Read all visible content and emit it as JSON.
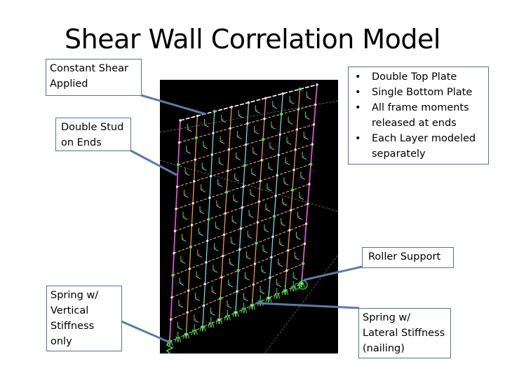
{
  "slide": {
    "title": "Shear Wall Correlation Model"
  },
  "callouts": {
    "constant_shear": {
      "lines": [
        "Constant Shear",
        "Applied"
      ]
    },
    "double_stud": {
      "lines": [
        "Double Stud",
        "on Ends"
      ]
    },
    "model_notes": {
      "bullets": [
        "Double Top Plate",
        "Single Bottom Plate",
        "All frame moments released at ends",
        "Each Layer modeled separately"
      ]
    },
    "roller_support": {
      "lines": [
        "Roller Support"
      ]
    },
    "spring_vertical": {
      "lines": [
        "Spring w/",
        "Vertical",
        "Stiffness",
        "only"
      ]
    },
    "spring_lateral": {
      "lines": [
        "Spring w/",
        "Lateral Stiffness",
        "(nailing)"
      ]
    }
  },
  "model": {
    "description": "Finite element frame model of shear wall",
    "grid_columns": 8,
    "grid_rows": 10,
    "colors": {
      "background": "#000000",
      "frame_horizontal": "#f0b48c",
      "stud_orange": "#e8964a",
      "stud_cyan": "#6fd8e0",
      "end_stud_magenta": "#e050d0",
      "node": "#f5e6dc",
      "spring": "#4ee04e",
      "leader_line": "#5a7ca8",
      "callout_border": "#5a7390"
    }
  }
}
